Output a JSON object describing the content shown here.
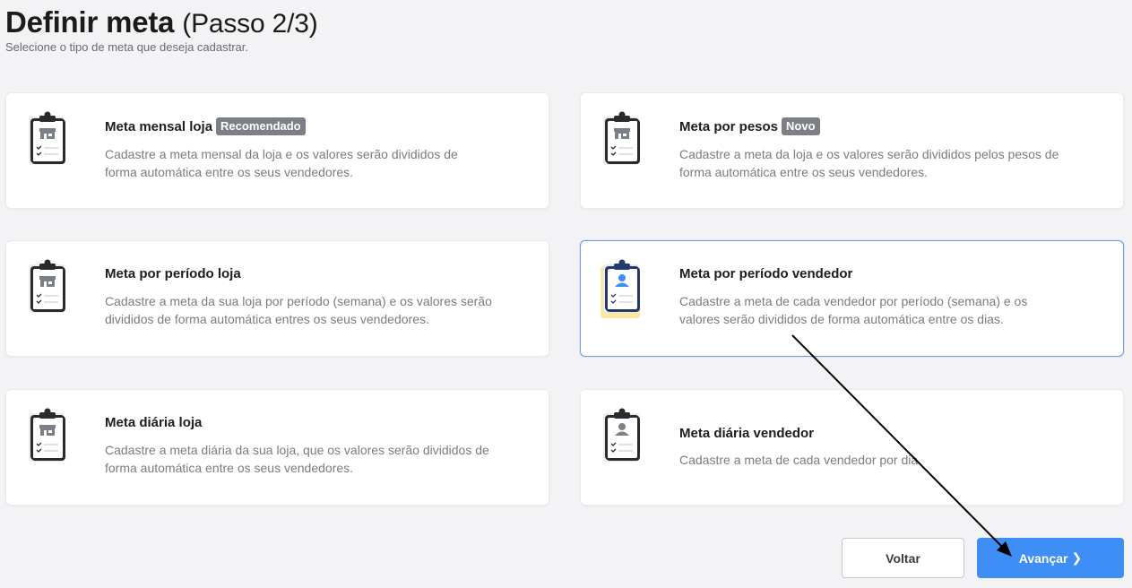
{
  "header": {
    "title": "Definir meta",
    "step": "(Passo 2/3)",
    "subtitle": "Selecione o tipo de meta que deseja cadastrar."
  },
  "cards": [
    {
      "title": "Meta mensal loja",
      "badge": "Recomendado",
      "desc_line1": "Cadastre a meta mensal da loja e os valores serão divididos de",
      "desc_line2": "forma automática entre os seus vendedores.",
      "icon": "store-clipboard-icon",
      "selected": false
    },
    {
      "title": "Meta por pesos",
      "badge": "Novo",
      "desc_line1": "Cadastre a meta da loja e os valores serão divididos pelos pesos de",
      "desc_line2": "forma automática entre os seus vendedores.",
      "icon": "store-clipboard-icon",
      "selected": false
    },
    {
      "title": "Meta por período loja",
      "desc_line1": "Cadastre a meta da sua loja por período (semana) e os valores serão",
      "desc_line2": "divididos de forma automática entres os seus vendedores.",
      "icon": "store-clipboard-icon",
      "selected": false
    },
    {
      "title": "Meta por período vendedor",
      "desc_line1": "Cadastre a meta de cada vendedor por período (semana) e os",
      "desc_line2": "valores serão divididos de forma automática entre os dias.",
      "icon": "person-clipboard-icon",
      "selected": true
    },
    {
      "title": "Meta diária loja",
      "desc_line1": "Cadastre a meta diária da sua loja, que os valores serão divididos de",
      "desc_line2": "forma automática entre os seus vendedores.",
      "icon": "store-clipboard-icon",
      "selected": false
    },
    {
      "title": "Meta diária vendedor",
      "desc_line1": "Cadastre a meta de cada vendedor por dia.",
      "desc_line2": "",
      "icon": "person-clipboard-icon",
      "selected": false
    }
  ],
  "buttons": {
    "back_label": "Voltar",
    "next_label": "Avançar",
    "next_chevron": "❯"
  },
  "colors": {
    "background": "#f3f3f5",
    "primary": "#3f8ef5",
    "selected_border": "#6e9ee6",
    "badge": "#7d7f86",
    "selected_icon_highlight": "#fde7a3",
    "person_icon": "#3f8ef5",
    "annotation_arrow": "#000000"
  }
}
